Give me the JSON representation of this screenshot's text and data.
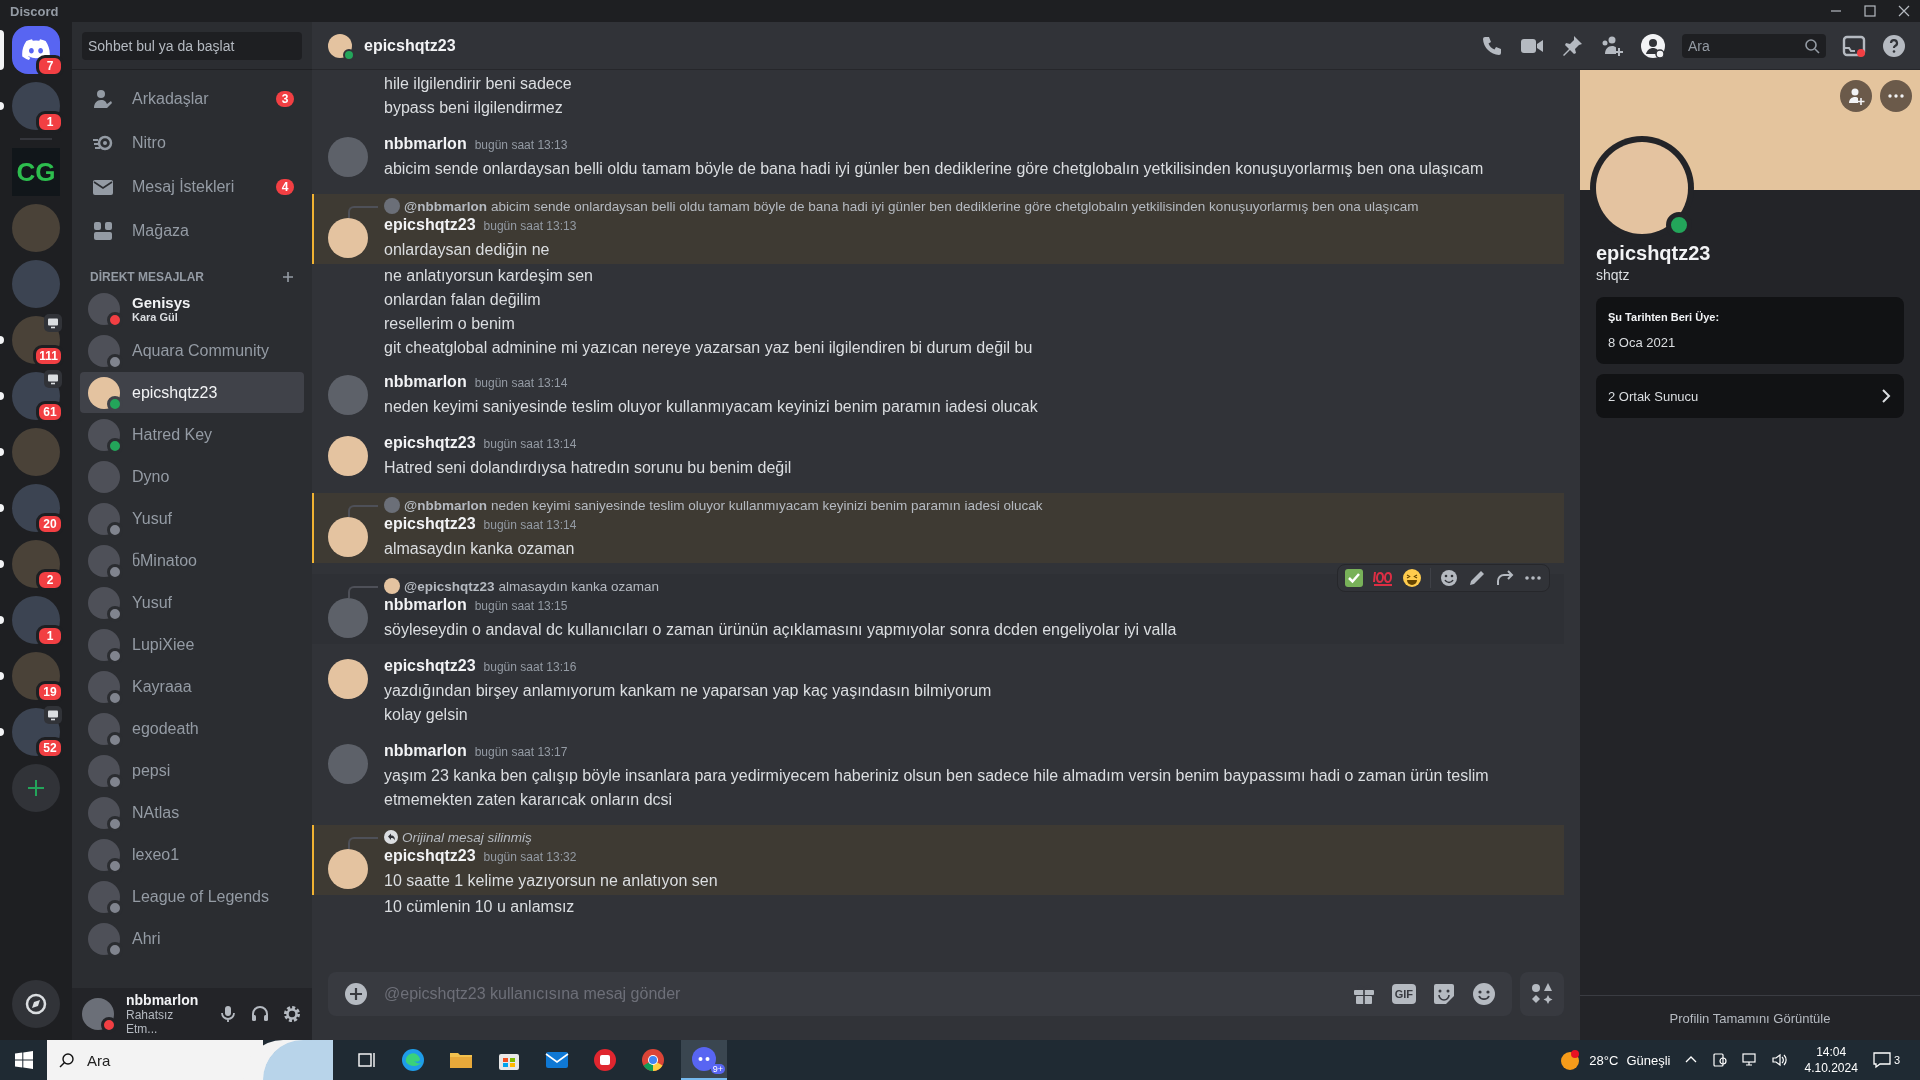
{
  "window": {
    "title": "Discord"
  },
  "servers": [
    {
      "kind": "home",
      "selected": true,
      "unread": false,
      "badge": "7",
      "screen": false
    },
    {
      "kind": "server",
      "selected": false,
      "unread": true,
      "badge": "1",
      "screen": false
    },
    {
      "kind": "separator"
    },
    {
      "kind": "server",
      "selected": false,
      "unread": false,
      "label": "CG",
      "screen": false
    },
    {
      "kind": "server",
      "selected": false,
      "unread": false,
      "screen": false
    },
    {
      "kind": "server",
      "selected": false,
      "unread": false,
      "screen": false
    },
    {
      "kind": "server",
      "selected": false,
      "unread": true,
      "badge": "111",
      "screen": true
    },
    {
      "kind": "server",
      "selected": false,
      "unread": true,
      "badge": "61",
      "screen": true
    },
    {
      "kind": "server",
      "selected": false,
      "unread": true,
      "screen": false
    },
    {
      "kind": "server",
      "selected": false,
      "unread": true,
      "badge": "20",
      "screen": false
    },
    {
      "kind": "server",
      "selected": false,
      "unread": true,
      "badge": "2",
      "screen": false
    },
    {
      "kind": "server",
      "selected": false,
      "unread": true,
      "badge": "1",
      "screen": false
    },
    {
      "kind": "server",
      "selected": false,
      "unread": true,
      "badge": "19",
      "screen": false
    },
    {
      "kind": "server",
      "selected": false,
      "unread": true,
      "badge": "52",
      "screen": true
    }
  ],
  "dm_search": {
    "placeholder": "Sohbet bul ya da başlat"
  },
  "dm_nav": [
    {
      "kind": "friends",
      "label": "Arkadaşlar",
      "badge": "3"
    },
    {
      "kind": "nitro",
      "label": "Nitro"
    },
    {
      "kind": "requests",
      "label": "Mesaj İstekleri",
      "badge": "4"
    },
    {
      "kind": "shop",
      "label": "Mağaza"
    }
  ],
  "dm_header": "DİREKT MESAJLAR",
  "dms": [
    {
      "name": "Genisys",
      "subtitle": "Kara Gül",
      "color": "#f23f43",
      "selected": false
    },
    {
      "name": "Aquara Community",
      "color": "#80848e",
      "selected": false
    },
    {
      "name": "epicshqtz23",
      "color": "#23a55a",
      "selected": true
    },
    {
      "name": "Hatred Key",
      "color": "#23a55a",
      "selected": false
    },
    {
      "name": "Dyno",
      "selected": false
    },
    {
      "name": "Yusuf",
      "color": "#80848e",
      "selected": false
    },
    {
      "name": "ნMinatoo",
      "color": "#80848e",
      "selected": false
    },
    {
      "name": "Yusuf",
      "color": "#80848e",
      "selected": false
    },
    {
      "name": "LupiXiee",
      "color": "#80848e",
      "selected": false
    },
    {
      "name": "Kayraaa",
      "color": "#80848e",
      "selected": false
    },
    {
      "name": "egodeath",
      "color": "#80848e",
      "selected": false
    },
    {
      "name": "pepsi",
      "color": "#80848e",
      "selected": false
    },
    {
      "name": "NAtlas",
      "color": "#80848e",
      "selected": false
    },
    {
      "name": "lexeo1",
      "color": "#80848e",
      "selected": false
    },
    {
      "name": "League of Legends",
      "color": "#80848e",
      "selected": false
    },
    {
      "name": "Ahri",
      "color": "#80848e",
      "selected": false
    }
  ],
  "user_panel": {
    "name": "nbbmarlon",
    "status_text": "Rahatsız Etm...",
    "color": "#f23f43"
  },
  "header": {
    "name": "epicshqtz23",
    "color": "#23a55a",
    "search_placeholder": "Ara"
  },
  "messages": [
    {
      "lines": [
        "hile ilgilendirir beni sadece",
        "bypass beni ilgilendirmez"
      ]
    },
    {
      "from_me": true,
      "author": "nbbmarlon",
      "time": "bugün saat 13:13",
      "lines": [
        "abicim sende onlardaysan belli oldu tamam böyle de bana hadi iyi günler ben dediklerine göre chetglobalın yetkilisinden konuşuyorlarmış ben ona ulaşıcam"
      ]
    },
    {
      "from_me": false,
      "mentioned": true,
      "reply": {
        "kind": "quote",
        "author": "@nbbmarlon",
        "text": "abicim sende onlardaysan belli oldu tamam böyle de bana hadi iyi günler ben dediklerine göre chetglobalın yetkilisinden konuşuyorlarmış ben ona ulaşıcam",
        "from_me": true
      },
      "author": "epicshqtz23",
      "time": "bugün saat 13:13",
      "lines": [
        "onlardaysan dediğin ne",
        "ne anlatıyorsun kardeşim sen",
        "onlardan falan değilim",
        "resellerim o benim",
        "git cheatglobal adminine mi yazıcan nereye yazarsan yaz beni ilgilendiren bi durum değil bu"
      ]
    },
    {
      "from_me": true,
      "author": "nbbmarlon",
      "time": "bugün saat 13:14",
      "lines": [
        "neden keyimi saniyesinde teslim oluyor kullanmıyacam keyinizi benim paramın iadesi olucak"
      ]
    },
    {
      "from_me": false,
      "author": "epicshqtz23",
      "time": "bugün saat 13:14",
      "lines": [
        "Hatred seni dolandırdıysa hatredın sorunu bu benim değil"
      ]
    },
    {
      "from_me": false,
      "mentioned": true,
      "reply": {
        "kind": "quote",
        "author": "@nbbmarlon",
        "text": "neden keyimi saniyesinde teslim oluyor kullanmıyacam keyinizi benim paramın iadesi olucak",
        "from_me": true
      },
      "author": "epicshqtz23",
      "time": "bugün saat 13:14",
      "lines": [
        "almasaydın kanka ozaman"
      ]
    },
    {
      "from_me": true,
      "hovered": true,
      "reply": {
        "kind": "quote",
        "author": "@epicshqtz23",
        "text": "almasaydın kanka ozaman",
        "from_me": false
      },
      "author": "nbbmarlon",
      "time": "bugün saat 13:15",
      "lines": [
        "söyleseydin o andaval dc kullanıcıları o zaman ürünün açıklamasını yapmıyolar sonra dcden engeliyolar iyi valla"
      ]
    },
    {
      "from_me": false,
      "author": "epicshqtz23",
      "time": "bugün saat 13:16",
      "lines": [
        "yazdığından birşey anlamıyorum kankam ne yaparsan yap kaç yaşındasın bilmiyorum",
        "kolay gelsin"
      ]
    },
    {
      "from_me": true,
      "author": "nbbmarlon",
      "time": "bugün saat 13:17",
      "lines": [
        "yaşım 23 kanka ben çalışıp böyle insanlara para yedirmiyecem haberiniz olsun ben sadece hile almadım versin benim baypassımı hadi o zaman ürün teslim etmemekten zaten kararıcak onların dcsi"
      ]
    },
    {
      "from_me": false,
      "mentioned": true,
      "reply": {
        "kind": "deleted",
        "text": "Orijinal mesaj silinmiş"
      },
      "author": "epicshqtz23",
      "time": "bugün saat 13:32",
      "lines": [
        "10 saatte 1 kelime yazıyorsun ne anlatıyon sen",
        "10 cümlenin 10 u anlamsız"
      ]
    }
  ],
  "composer": {
    "placeholder": "@epicshqtz23 kullanıcısına mesaj gönder",
    "gif_label": "GIF"
  },
  "profile": {
    "name": "epicshqtz23",
    "username": "shqtz",
    "color": "#23a55a",
    "member_since_label": "Şu Tarihten Beri Üye:",
    "member_since": "8 Oca 2021",
    "mutual_servers": "2 Ortak Sunucu",
    "footer": "Profilin Tamamını Görüntüle"
  },
  "taskbar": {
    "search_placeholder": "Ara",
    "discord_badge": "9+",
    "temperature": "28°C",
    "weather": "Güneşli",
    "time": "14:04",
    "date": "4.10.2024",
    "notifications": "3"
  }
}
